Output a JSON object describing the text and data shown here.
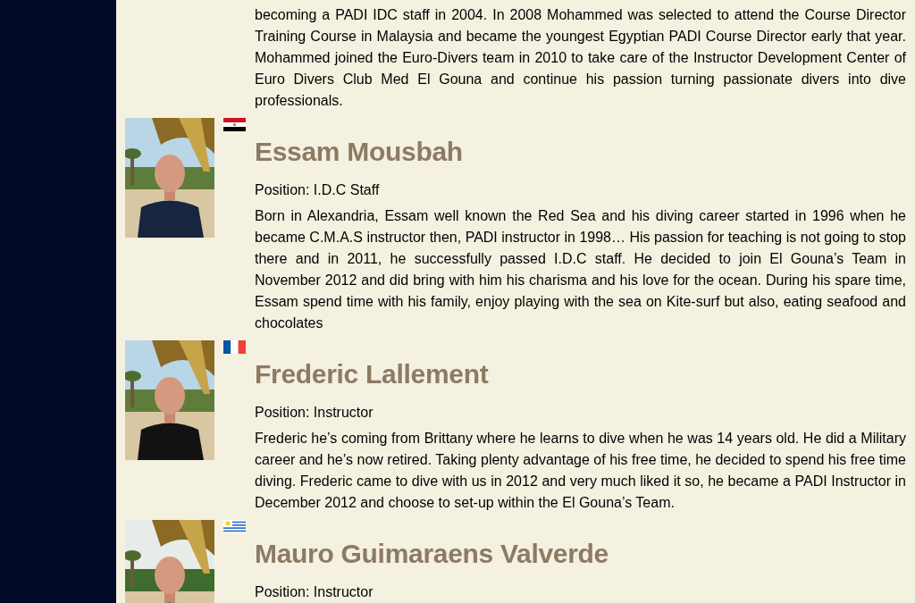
{
  "intro": {
    "bio": "becoming a PADI IDC staff in 2004. In 2008 Mohammed was selected to attend the Course Director Training Course in Malaysia and became the youngest Egyptian PADI Course Director early that year. Mohammed joined the Euro-Divers team in 2010 to take care of the Instructor Development Center of Euro Divers Club Med El Gouna and continue his passion turning passionate divers into dive professionals."
  },
  "staff": [
    {
      "name": "Essam Mousbah",
      "flag": {
        "kind": "egypt"
      },
      "position": "Position: I.D.C Staff",
      "bio": "Born in Alexandria, Essam well known the Red Sea and his diving career started in 1996 when he became C.M.A.S instructor then, PADI instructor in 1998… His passion for teaching is not going to stop there and in 2011, he successfully passed I.D.C staff. He decided to join El Gouna’s Team in November 2012 and did bring with him his charisma and his love for the ocean. During his spare time, Essam spend time with his family, enjoy playing with the sea on Kite-surf but also, eating seafood and chocolates"
    },
    {
      "name": "Frederic Lallement",
      "flag": {
        "kind": "france"
      },
      "position": "Position: Instructor",
      "bio": "Frederic he’s coming from Brittany where he learns to dive when he was 14 years old. He did a Military career and he’s now retired. Taking plenty advantage of his free time, he decided to spend his free time diving. Frederic came to dive with us in 2012 and very much liked it so, he became a PADI Instructor in December 2012 and choose to set-up within the El Gouna’s Team."
    },
    {
      "name": "Mauro Guimaraens Valverde",
      "flag": {
        "kind": "uruguay"
      },
      "position": "Position: Instructor"
    }
  ]
}
